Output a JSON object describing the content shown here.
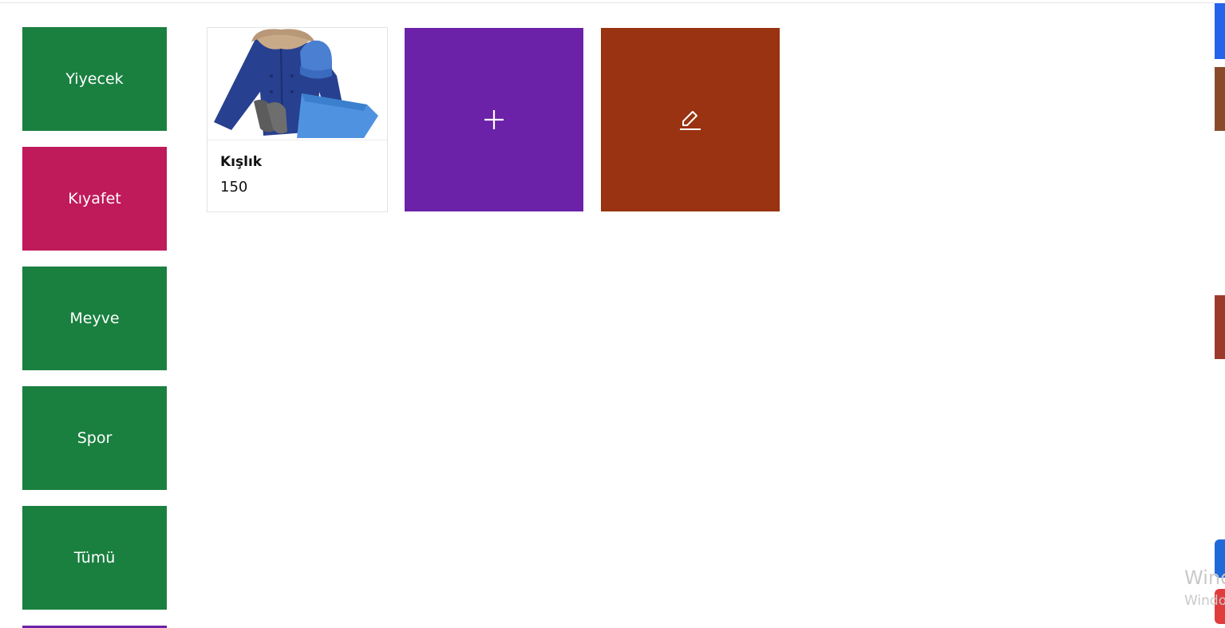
{
  "colors": {
    "green": "#1a8040",
    "pink": "#bf1a5a",
    "purple": "#6b21a8",
    "rust": "#993311",
    "blue": "#2563eb"
  },
  "categories": [
    {
      "label": "Yiyecek",
      "color": "#1a8040"
    },
    {
      "label": "Kıyafet",
      "color": "#bf1a5a"
    },
    {
      "label": "Meyve",
      "color": "#1a8040"
    },
    {
      "label": "Spor",
      "color": "#1a8040"
    },
    {
      "label": "Tümü",
      "color": "#1a8040"
    }
  ],
  "products": [
    {
      "name": "Kışlık",
      "price": "150",
      "image": "winter-clothing-photo"
    }
  ],
  "actions": {
    "add_icon": "plus-icon",
    "edit_icon": "pencil-icon"
  },
  "watermark": {
    "line1": "Wind",
    "line2": "Windo"
  }
}
